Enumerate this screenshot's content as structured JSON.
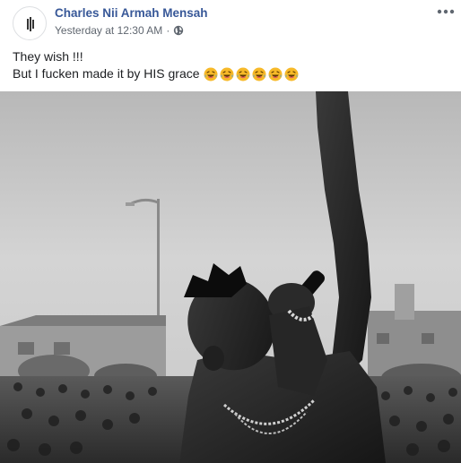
{
  "post": {
    "author": "Charles Nii Armah Mensah",
    "timestamp": "Yesterday at 12:30 AM",
    "separator": "·",
    "privacy_icon": "globe-icon",
    "more_icon": "more-options-icon",
    "text_line_1": "They wish !!!",
    "text_line_2": "But I fucken made it by HIS grace",
    "emojis": [
      "laughing-crying-emoji",
      "laughing-crying-emoji",
      "laughing-crying-emoji",
      "laughing-crying-emoji",
      "laughing-crying-emoji",
      "laughing-crying-emoji"
    ],
    "photo": "black-and-white concert performer photo"
  },
  "colors": {
    "author_link": "#385898",
    "meta_text": "#606770",
    "body_text": "#1c1e21"
  }
}
